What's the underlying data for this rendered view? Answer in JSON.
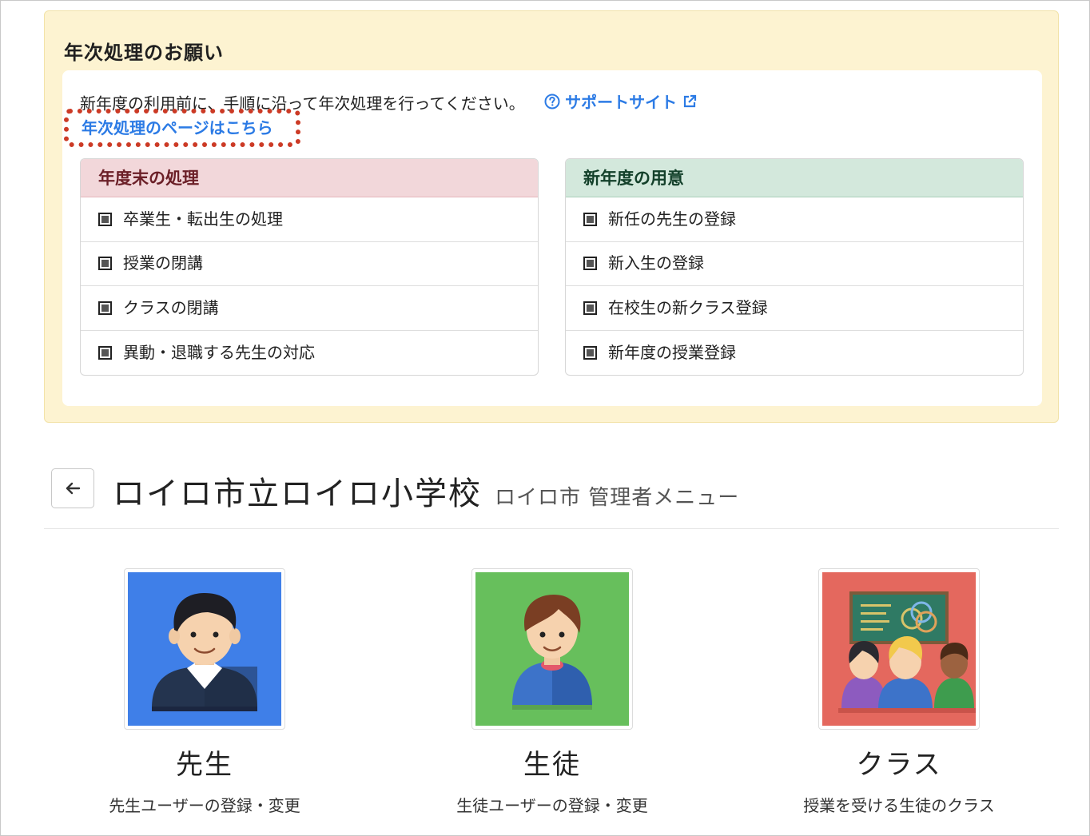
{
  "notice": {
    "title": "年次処理のお願い",
    "intro_text": "新年度の利用前に、手順に沿って年次処理を行ってください。",
    "support_link_label": "サポートサイト",
    "annual_link_label": "年次処理のページはこちら"
  },
  "year_end_panel": {
    "heading": "年度末の処理",
    "items": [
      "卒業生・転出生の処理",
      "授業の閉講",
      "クラスの閉講",
      "異動・退職する先生の対応"
    ]
  },
  "new_year_panel": {
    "heading": "新年度の用意",
    "items": [
      "新任の先生の登録",
      "新入生の登録",
      "在校生の新クラス登録",
      "新年度の授業登録"
    ]
  },
  "school": {
    "name": "ロイロ市立ロイロ小学校",
    "subtitle": "ロイロ市 管理者メニュー"
  },
  "menu": {
    "teachers": {
      "title": "先生",
      "description": "先生ユーザーの登録・変更"
    },
    "students": {
      "title": "生徒",
      "description": "生徒ユーザーの登録・変更"
    },
    "classes": {
      "title": "クラス",
      "description": "授業を受ける生徒のクラス"
    }
  },
  "colors": {
    "link": "#2c7be5",
    "highlight_border": "#cc3a25",
    "teacher_tile": "#3f7fe8",
    "student_tile": "#67bf5c",
    "class_tile": "#e4685e"
  }
}
